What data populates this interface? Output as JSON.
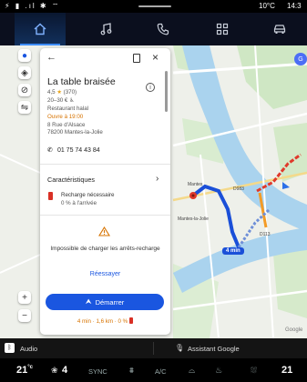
{
  "status": {
    "icons": "⚡ ▮ .ıl ✱ ⌔",
    "temp": "10°C",
    "time": "14:3"
  },
  "nav": {
    "tabs": [
      "home",
      "music",
      "phone",
      "apps",
      "car"
    ]
  },
  "map": {
    "route_time": "4 min",
    "labels": [
      "Mantes-la-Jolie",
      "Mantes",
      "D983",
      "D113"
    ],
    "google": "Google"
  },
  "place": {
    "name": "La table braisée",
    "rating": "4,5",
    "reviews": "(370)",
    "price": "20–30 €",
    "category": "Restaurant halal",
    "hours": "Ouvre à 19:00",
    "address_line1": "8 Rue d'Alsace",
    "address_line2": "78200 Mantes-la-Jolie",
    "phone": "01 75 74 43 84",
    "features_title": "Caractéristiques",
    "charge_needed": "Recharge nécessaire",
    "charge_arrival": "0 % à l'arrivée",
    "warning": "Impossible de charger les arrêts-recharge",
    "retry": "Réessayer",
    "start": "Démarrer",
    "trip_summary": "4 min · 1,6 km · 0 %"
  },
  "media": {
    "source": "Audio",
    "assistant": "Assistant Google"
  },
  "climate": {
    "left_temp": "21",
    "fan": "4",
    "sync": "SYNC",
    "ac": "A/C",
    "right_temp": "21"
  }
}
